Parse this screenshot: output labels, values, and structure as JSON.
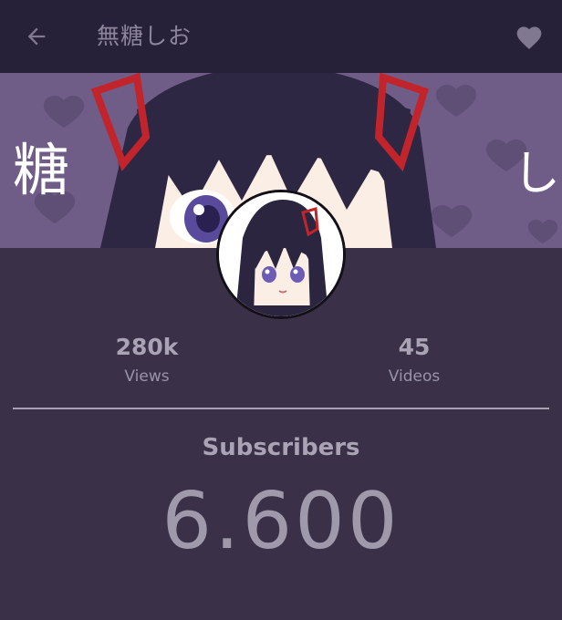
{
  "header": {
    "title": "無糖しお",
    "back_icon": "arrow-left-icon",
    "favorite_icon": "heart-icon"
  },
  "banner": {
    "left_text": "糖",
    "right_text": "し"
  },
  "stats": {
    "views": {
      "value": "280k",
      "label": "Views"
    },
    "videos": {
      "value": "45",
      "label": "Videos"
    }
  },
  "subscribers": {
    "label": "Subscribers",
    "count": "6.600"
  },
  "colors": {
    "background": "#3a3149",
    "topbar": "#262039",
    "banner": "#6f5d87",
    "text": "#a9a3b5"
  }
}
